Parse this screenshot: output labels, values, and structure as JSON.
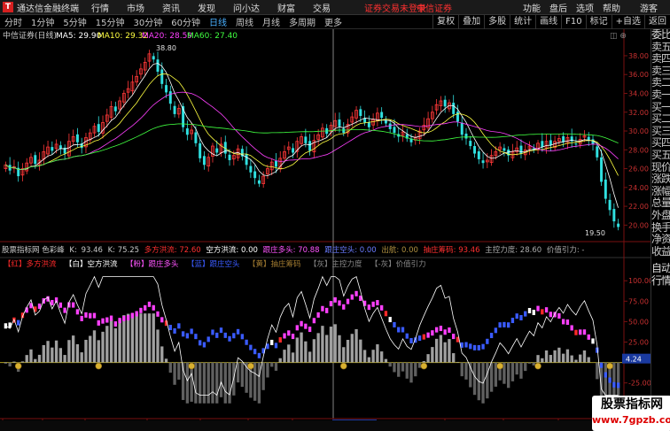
{
  "top_bar": {
    "app_name": "通达信金融终端",
    "menus": [
      "行情",
      "市场",
      "资讯",
      "发现",
      "问小达",
      "财富",
      "交易"
    ],
    "login_warning": "证券交易未登录",
    "broker": "中信证券",
    "right": [
      "功能",
      "盘后",
      "选项",
      "帮助"
    ],
    "guest": "游客"
  },
  "period_tabs": [
    "分时",
    "1分钟",
    "5分钟",
    "15分钟",
    "30分钟",
    "60分钟",
    "日线",
    "周线",
    "月线",
    "多周期",
    "更多"
  ],
  "period_selected": "日线",
  "right_tools": [
    "复权",
    "叠加",
    "多股",
    "统计",
    "画线",
    "F10",
    "标记",
    "+自选",
    "返回"
  ],
  "title_bar": {
    "name": "中信证券(日线)",
    "ma5": "MA5: 29.90",
    "ma10": "MA10: 29.32",
    "ma20": "MA20: 28.59",
    "ma60": "MA60: 27.40"
  },
  "price_axis": [
    "38.00",
    "36.00",
    "34.00",
    "32.00",
    "30.00",
    "28.00",
    "26.00",
    "24.00",
    "22.00",
    "20.00"
  ],
  "high_label": "38.80",
  "low_label": "19.50",
  "indicator": {
    "name": "股票指标网 色彩峰",
    "k_label": "K:",
    "k_val": "93.46",
    "k2": "K: 75.25",
    "duo": "多方洪流: 72.60",
    "kong": "空方洪流: 0.00",
    "gensui_duo": "跟庄多头: 70.88",
    "gensui_kong": "跟庄空头: 0.00",
    "chu": "出航: 0.00",
    "zhuang": "抽庄筹码: 93.46",
    "zhukong": "主控力度: 28.60",
    "jiazhi": "价值引力: -"
  },
  "legend": [
    {
      "tag": "【红】",
      "label": "多方洪流",
      "color": "#ff2a2a"
    },
    {
      "tag": "【白】",
      "label": "空方洪流",
      "color": "#ffffff"
    },
    {
      "tag": "【粉】",
      "label": "跟庄多头",
      "color": "#ff55ff"
    },
    {
      "tag": "【蓝】",
      "label": "跟庄空头",
      "color": "#3a5bff"
    },
    {
      "tag": "【黄】",
      "label": "抽庄筹码",
      "color": "#a07a30"
    },
    {
      "tag": "【灰】",
      "label": "主控力度",
      "color": "#888888"
    },
    {
      "tag": "【-灰】",
      "label": "价值引力",
      "color": "#888888"
    }
  ],
  "ind_axis": [
    "100.00",
    "75.00",
    "50.00",
    "25.00",
    "4.24",
    "-25.00",
    "-50.00"
  ],
  "ind_cur": "4.24",
  "date_axis": [
    "2009年",
    "6",
    "7",
    "8",
    "9",
    "10",
    "11",
    "2009/11/18(三)",
    "2",
    "3",
    "4"
  ],
  "right_panel": [
    "委比",
    "卖五",
    "卖四",
    "卖三",
    "卖二",
    "卖一",
    "买一",
    "买二",
    "买三",
    "买四",
    "买五",
    "现价",
    "涨跌",
    "涨幅",
    "总量",
    "外盘",
    "换手",
    "净资",
    "收益",
    "自动",
    "行情"
  ],
  "watermark": {
    "line1": "股票指标网",
    "line2": "www.7gpzb.com"
  },
  "chart_data": {
    "type": "candlestick",
    "title": "中信证券(日线)",
    "ylim": [
      19.0,
      39.5
    ],
    "yticks": [
      20,
      22,
      24,
      26,
      28,
      30,
      32,
      34,
      36,
      38
    ],
    "close": [
      26.4,
      25.8,
      26.2,
      25.2,
      26.0,
      26.6,
      27.2,
      26.5,
      26.9,
      27.8,
      28.3,
      27.9,
      28.6,
      28.1,
      27.6,
      28.9,
      29.4,
      28.8,
      28.2,
      29.3,
      29.8,
      30.5,
      29.9,
      30.9,
      31.7,
      32.6,
      32.1,
      33.2,
      34.0,
      34.5,
      35.2,
      35.8,
      36.6,
      37.3,
      38.2,
      37.6,
      36.3,
      35.0,
      34.1,
      32.9,
      31.8,
      32.4,
      30.4,
      29.6,
      30.1,
      28.7,
      27.1,
      26.4,
      27.2,
      28.4,
      27.7,
      28.6,
      27.6,
      26.9,
      27.4,
      28.1,
      27.3,
      26.4,
      25.6,
      25.0,
      24.4,
      25.2,
      26.0,
      26.7,
      26.2,
      27.1,
      27.8,
      28.3,
      27.7,
      28.9,
      29.4,
      28.7,
      27.9,
      29.0,
      29.6,
      30.3,
      29.7,
      30.6,
      31.1,
      30.5,
      29.8,
      30.7,
      31.5,
      32.2,
      31.6,
      30.9,
      30.4,
      31.2,
      31.9,
      31.4,
      30.8,
      30.2,
      29.8,
      29.4,
      29.9,
      29.2,
      28.8,
      29.3,
      30.0,
      30.6,
      31.3,
      32.0,
      32.8,
      33.2,
      32.6,
      33.0,
      31.8,
      31.0,
      29.6,
      29.2,
      28.4,
      27.6,
      27.0,
      26.6,
      26.9,
      27.4,
      27.8,
      28.3,
      27.9,
      27.4,
      27.8,
      28.2,
      27.6,
      28.0,
      28.4,
      28.0,
      28.7,
      28.3,
      28.9,
      28.5,
      28.9,
      29.2,
      28.8,
      29.3,
      28.9,
      28.6,
      29.1,
      29.5,
      29.0,
      28.6,
      27.2,
      24.6,
      22.8,
      21.6,
      20.4,
      19.8
    ],
    "ma_labels": [
      "MA5",
      "MA10",
      "MA20",
      "MA60"
    ]
  }
}
